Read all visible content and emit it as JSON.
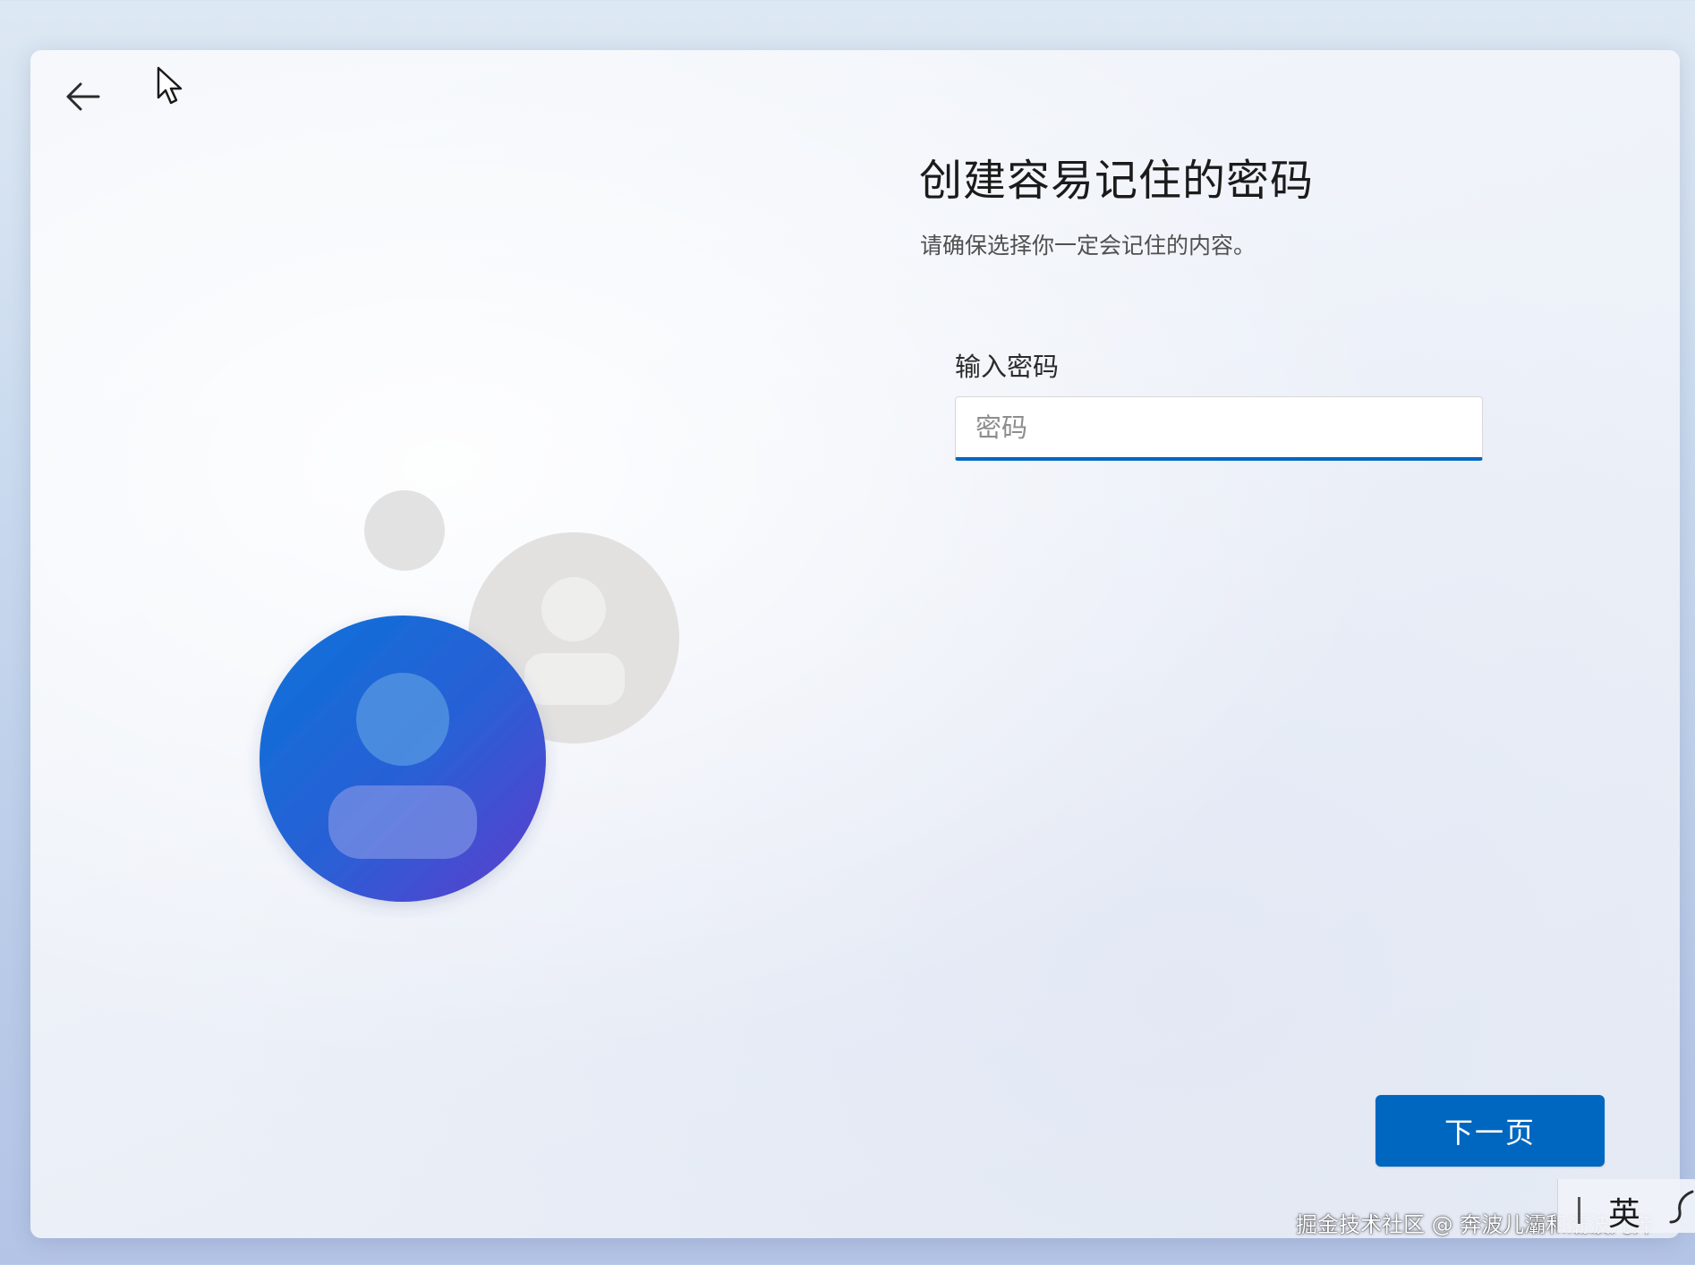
{
  "screen": {
    "title": "创建容易记住的密码",
    "subtitle": "请确保选择你一定会记住的内容。"
  },
  "password_field": {
    "label": "输入密码",
    "placeholder": "密码",
    "value": ""
  },
  "buttons": {
    "back_icon": "back-arrow-icon",
    "next_label": "下一页"
  },
  "ime": {
    "mode_label": "英",
    "icon": "ime-settings-icon"
  },
  "watermark": "掘金技术社区 @ 奔波儿灞和灞波儿奔",
  "illustration": {
    "icon": "user-accounts-icon"
  },
  "colors": {
    "accent": "#0067c0",
    "avatar_gradient_start": "#0a6fd6",
    "avatar_gradient_end": "#5b3fcf",
    "secondary_avatar": "#e1e1e1"
  }
}
